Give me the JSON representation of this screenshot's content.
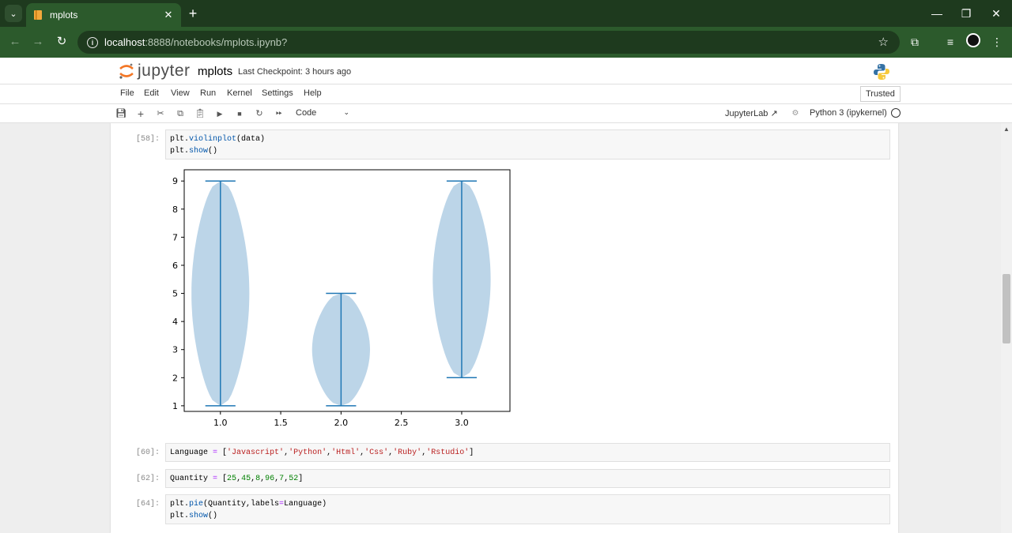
{
  "browser": {
    "tab_title": "mplots",
    "url_host": "localhost",
    "url_rest": ":8888/notebooks/mplots.ipynb?"
  },
  "jupyter": {
    "logo_text": "jupyter",
    "notebook_title": "mplots",
    "checkpoint": "Last Checkpoint: 3 hours ago",
    "menu": [
      "File",
      "Edit",
      "View",
      "Run",
      "Kernel",
      "Settings",
      "Help"
    ],
    "trusted": "Trusted",
    "cell_type": "Code",
    "jupyterlab_link": "JupyterLab",
    "kernel": "Python 3 (ipykernel)"
  },
  "cells": [
    {
      "prompt": "[58]:",
      "lines": [
        "plt.violinplot(data)",
        "plt.show()"
      ]
    },
    {
      "prompt": "[60]:",
      "lines": [
        "Language = ['Javascript','Python','Html','Css','Ruby','Rstudio']"
      ]
    },
    {
      "prompt": "[62]:",
      "lines": [
        "Quantity = [25,45,8,96,7,52]"
      ]
    },
    {
      "prompt": "[64]:",
      "lines": [
        "plt.pie(Quantity,labels=Language)",
        "plt.show()"
      ]
    }
  ],
  "chart_data": {
    "type": "violin",
    "xlim": [
      0.7,
      3.4
    ],
    "ylim": [
      0.8,
      9.4
    ],
    "xticks": [
      "1.0",
      "1.5",
      "2.0",
      "2.5",
      "3.0"
    ],
    "yticks": [
      "1",
      "2",
      "3",
      "4",
      "5",
      "6",
      "7",
      "8",
      "9"
    ],
    "violins": [
      {
        "position": 1.0,
        "min": 1,
        "max": 9
      },
      {
        "position": 2.0,
        "min": 1,
        "max": 5
      },
      {
        "position": 3.0,
        "min": 2,
        "max": 9
      }
    ],
    "colors": {
      "body": "#bcd5e8",
      "line": "#1f77b4"
    }
  }
}
